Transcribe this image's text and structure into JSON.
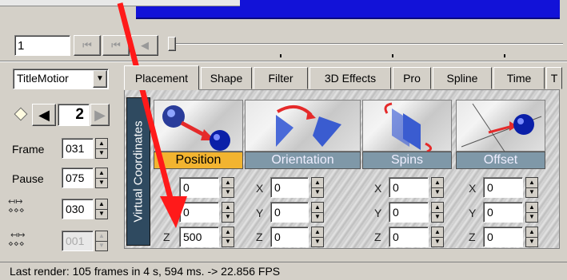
{
  "playback": {
    "frame_value": "1"
  },
  "left": {
    "dropdown_value": "TitleMotior",
    "keyframe_value": "2",
    "frame_label": "Frame",
    "frame_value": "031",
    "pause_label": "Pause",
    "pause_value": "075",
    "dist1_value": "030",
    "dist2_value": "001"
  },
  "tabs": [
    "Placement",
    "Shape",
    "Filter",
    "3D Effects",
    "Pro",
    "Spline",
    "Time",
    "T"
  ],
  "vertical_label": "Virtual Coordinates",
  "tiles": [
    "Position",
    "Orientation",
    "Spins",
    "Offset"
  ],
  "fields": {
    "position": {
      "x": "0",
      "y": "0",
      "z_label": "Z",
      "z": "500"
    },
    "orientation": {
      "x_label": "X",
      "x": "0",
      "y_label": "Y",
      "y": "0",
      "z_label": "Z",
      "z": "0"
    },
    "spins": {
      "x_label": "X",
      "x": "0",
      "y_label": "Y",
      "y": "0",
      "z_label": "Z",
      "z": "0"
    },
    "offset": {
      "x_label": "X",
      "x": "0",
      "y_label": "Y",
      "y": "0",
      "z_label": "Z",
      "z": "0"
    }
  },
  "status": "Last render: 105 frames in 4 s, 594 ms. -> 22.856 FPS"
}
